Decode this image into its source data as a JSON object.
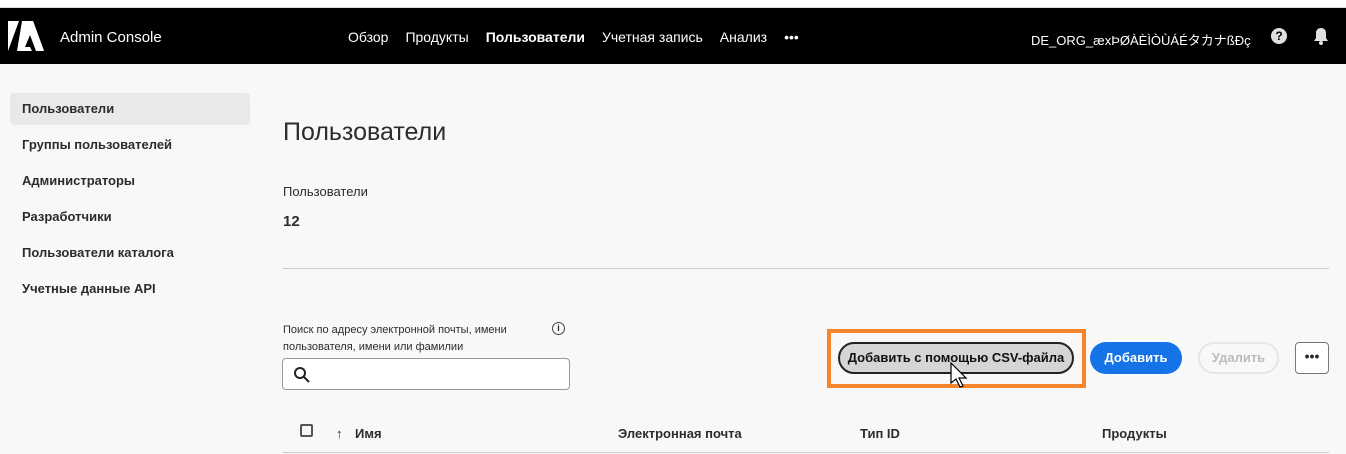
{
  "header": {
    "app_name": "Admin Console",
    "nav": [
      "Обзор",
      "Продукты",
      "Пользователи",
      "Учетная запись",
      "Анализ",
      "•••"
    ],
    "active_nav": 2,
    "org": "DE_ORG_æxÞØÀÈÌÒÙÁÉタカナßÐç",
    "help_icon": "?"
  },
  "sidebar": {
    "items": [
      "Пользователи",
      "Группы пользователей",
      "Администраторы",
      "Разработчики",
      "Пользователи каталога",
      "Учетные данные API"
    ]
  },
  "main": {
    "title": "Пользователи",
    "users_label": "Пользователи",
    "users_count": "12",
    "search_label": "Поиск по адресу электронной почты, имени пользователя, имени или фамилии",
    "info_icon": "i",
    "csv_button": "Добавить с помощью CSV-файла",
    "add_button": "Добавить",
    "delete_button": "Удалить",
    "more_button": "•••",
    "columns": [
      "Имя",
      "Электронная почта",
      "Тип ID",
      "Продукты"
    ],
    "sort_icon": "↑"
  },
  "colors": {
    "accent": "#1473e6",
    "highlight": "#f6852b"
  }
}
